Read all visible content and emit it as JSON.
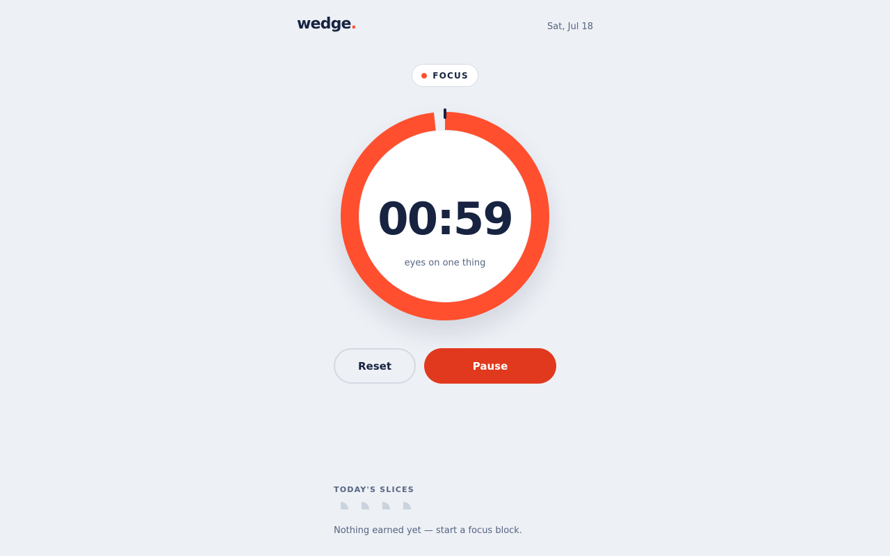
{
  "app": {
    "logo_text": "wedge",
    "logo_dot": "."
  },
  "header": {
    "date": "Sat, Jul 18"
  },
  "mode": {
    "label": "FOCUS"
  },
  "timer": {
    "display": "00:59",
    "caption": "eyes on one thing",
    "progress_fraction": 0.983
  },
  "controls": {
    "reset_label": "Reset",
    "pause_label": "Pause"
  },
  "slices": {
    "title": "TODAY'S SLICES",
    "count": 4,
    "empty_message": "Nothing earned yet — start a focus block."
  },
  "colors": {
    "accent": "#ff4f2e",
    "accent_dark": "#e0391d",
    "ink": "#172340",
    "muted": "#556482",
    "slice_placeholder": "#cbd3df"
  },
  "icons": {
    "slice": "pie-slice-icon",
    "mode_dot": "status-dot-icon"
  }
}
